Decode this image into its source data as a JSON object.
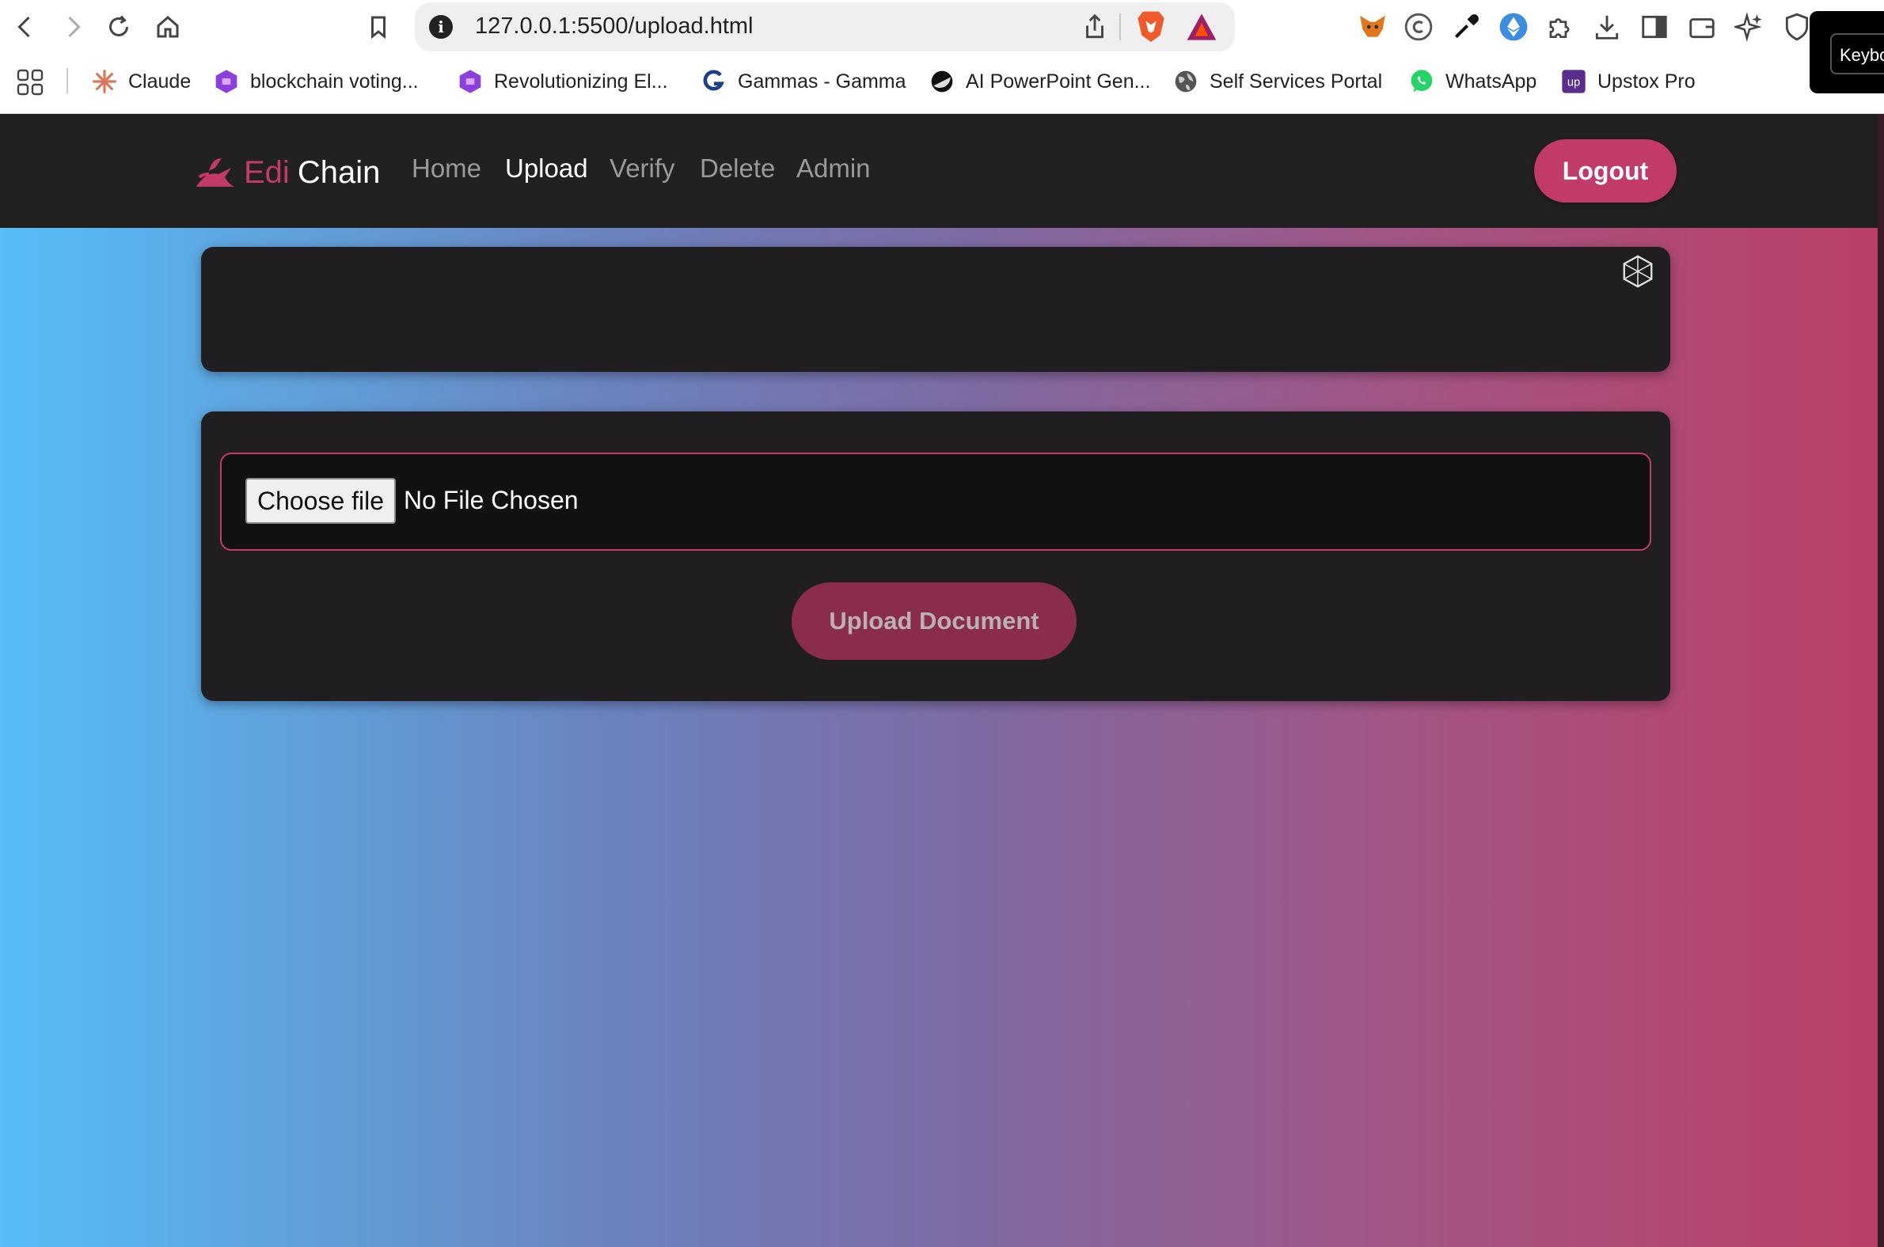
{
  "browser": {
    "url": "127.0.0.1:5500/upload.html",
    "popup_text": "Keybo",
    "bookmarks": [
      {
        "label": "Claude",
        "icon": "claude-icon"
      },
      {
        "label": "blockchain voting...",
        "icon": "hexagon-icon"
      },
      {
        "label": "Revolutionizing El...",
        "icon": "hexagon-icon"
      },
      {
        "label": "Gammas - Gamma",
        "icon": "gamma-icon"
      },
      {
        "label": "AI PowerPoint Gen...",
        "icon": "half-circle-icon"
      },
      {
        "label": "Self Services Portal",
        "icon": "globe-icon"
      },
      {
        "label": "WhatsApp",
        "icon": "whatsapp-icon"
      },
      {
        "label": "Upstox Pro",
        "icon": "upstox-icon"
      }
    ]
  },
  "app": {
    "brand_first": "Edi",
    "brand_second": "Chain",
    "nav": [
      "Home",
      "Upload",
      "Verify",
      "Delete",
      "Admin"
    ],
    "active_nav": "Upload",
    "logout_label": "Logout",
    "choose_file_label": "Choose file",
    "file_status": "No File Chosen",
    "upload_button_label": "Upload Document",
    "colors": {
      "accent": "#c23a68",
      "navbar": "#212121",
      "card": "#211e22",
      "gradient_start": "#56bdf7",
      "gradient_end": "#bb3f68"
    }
  }
}
